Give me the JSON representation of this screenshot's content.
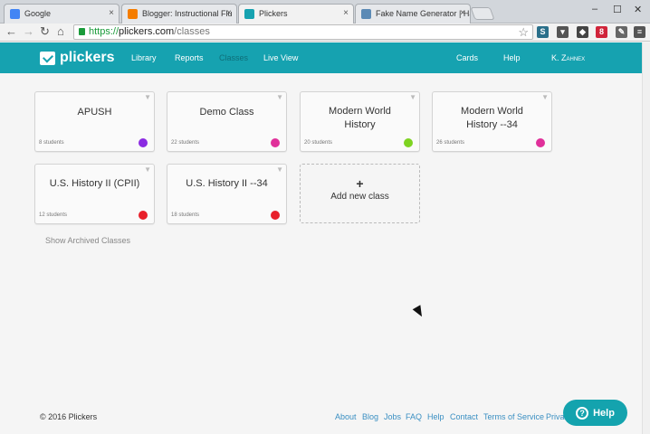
{
  "browser": {
    "tabs": [
      {
        "title": "Google",
        "favicon_color": "#4285f4"
      },
      {
        "title": "Blogger: Instructional Flu",
        "favicon_color": "#f57d00"
      },
      {
        "title": "Plickers",
        "favicon_color": "#16a2b0"
      },
      {
        "title": "Fake Name Generator | Ha",
        "favicon_color": "#5b8ab5"
      }
    ],
    "close_glyph": "×",
    "window_controls": [
      "–",
      "☐",
      "✕"
    ],
    "url": {
      "scheme": "https://",
      "host": "plickers.com",
      "path": "/classes"
    },
    "extensions": [
      {
        "label": "S",
        "color": "#2a6f8a"
      },
      {
        "label": "▾",
        "color": "#555555"
      },
      {
        "label": "◆",
        "color": "#444444"
      },
      {
        "label": "8",
        "color": "#d0243a"
      },
      {
        "label": "✎",
        "color": "#666666"
      },
      {
        "label": "≡",
        "color": "#555555"
      }
    ]
  },
  "site": {
    "brand": "plickers",
    "nav_left": [
      "Library",
      "Reports",
      "Classes",
      "Live View"
    ],
    "nav_right": [
      "Cards",
      "Help",
      "K. Zahnex"
    ]
  },
  "classes": [
    {
      "name": "APUSH",
      "students": "8 students",
      "color": "#8b2be2"
    },
    {
      "name": "Demo Class",
      "students": "22 students",
      "color": "#e0309a"
    },
    {
      "name": "Modern World History",
      "students": "20 students",
      "color": "#7ed321"
    },
    {
      "name": "Modern World History --34",
      "students": "26 students",
      "color": "#e0309a"
    },
    {
      "name": "U.S. History II (CPII)",
      "students": "12 students",
      "color": "#e8202a"
    },
    {
      "name": "U.S. History II --34",
      "students": "18 students",
      "color": "#e8202a"
    }
  ],
  "add_class": {
    "plus": "+",
    "label": "Add new class"
  },
  "show_archived": "Show Archived Classes",
  "footer": {
    "copyright": "© 2016 Plickers",
    "links": [
      "About",
      "Blog",
      "Jobs",
      "FAQ",
      "Help",
      "Contact",
      "Terms of Service",
      "Priva"
    ]
  },
  "help_button": {
    "icon": "?",
    "label": "Help"
  }
}
